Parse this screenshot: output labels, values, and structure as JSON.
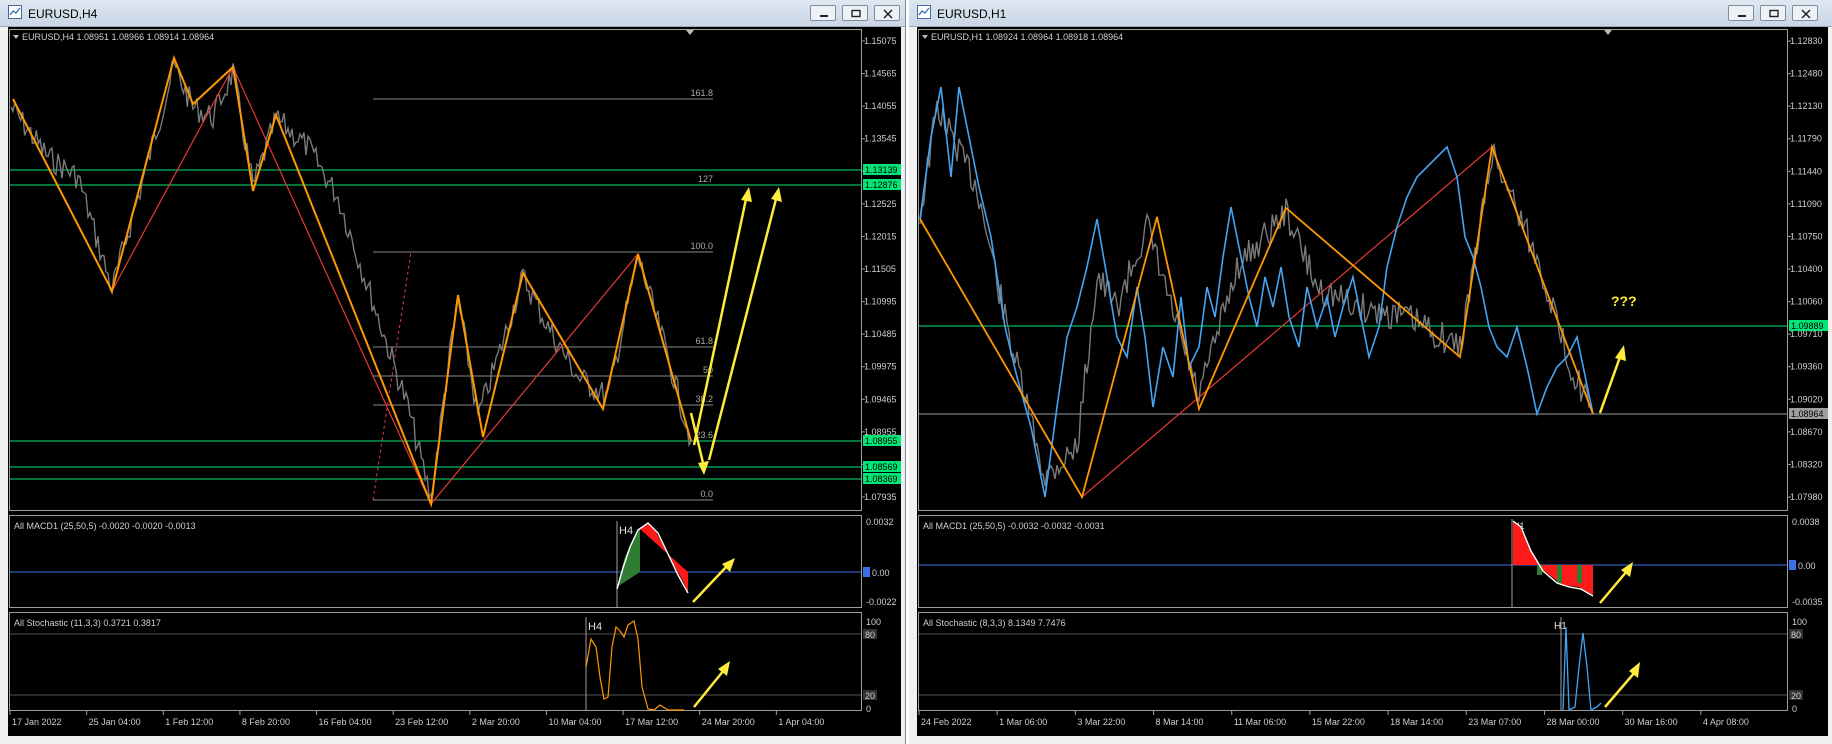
{
  "windows": {
    "left": {
      "title": "EURUSD,H4",
      "header": "EURUSD,H4  1.08951 1.08966 1.08914 1.08964",
      "price_ticks": [
        "1.15075",
        "1.14565",
        "1.14055",
        "1.13545",
        "1.13035",
        "1.12525",
        "1.12015",
        "1.11505",
        "1.10995",
        "1.10485",
        "1.09975",
        "1.09465",
        "1.08955",
        "1.08445",
        "1.07935"
      ],
      "price_labels": [
        {
          "text": "1.13139",
          "color": "#00e676"
        },
        {
          "text": "1.12876",
          "color": "#00e676"
        },
        {
          "text": "1.08955",
          "color": "#00e676"
        },
        {
          "text": "1.08569",
          "color": "#00e676"
        },
        {
          "text": "1.08369",
          "color": "#00e676"
        }
      ],
      "fib_levels": [
        "161.8",
        "127",
        "100.0",
        "61.8",
        "50",
        "38.2",
        "23.6",
        "0.0"
      ],
      "time_labels": [
        "17 Jan 2022",
        "25 Jan 04:00",
        "1 Feb 12:00",
        "8 Feb 20:00",
        "16 Feb 04:00",
        "23 Feb 12:00",
        "2 Mar 20:00",
        "10 Mar 04:00",
        "17 Mar 12:00",
        "24 Mar 20:00",
        "1 Apr 04:00"
      ],
      "macd": {
        "label": "All MACD1 (25,50,5) -0.0020 -0.0020 -0.0013",
        "top": "0.0032",
        "zero": "0.00",
        "bottom": "-0.0022",
        "tf": "H4"
      },
      "stoch": {
        "label": "All Stochastic (11,3,3) 0.3721 0.3817",
        "l100": "100",
        "l80": "80",
        "l20": "20",
        "l0": "0",
        "tf": "H4"
      }
    },
    "right": {
      "title": "EURUSD,H1",
      "header": "EURUSD,H1  1.08924 1.08964 1.08918 1.08964",
      "price_ticks": [
        "1.12830",
        "1.12480",
        "1.12130",
        "1.11790",
        "1.11440",
        "1.11090",
        "1.10750",
        "1.10400",
        "1.10060",
        "1.09710",
        "1.09360",
        "1.09020",
        "1.08670",
        "1.08320",
        "1.07980"
      ],
      "price_labels": [
        {
          "text": "1.09889",
          "color": "#00e676"
        },
        {
          "text": "1.08964",
          "color": "#9e9e9e"
        }
      ],
      "annotation": "???",
      "time_labels": [
        "24 Feb 2022",
        "1 Mar 06:00",
        "3 Mar 22:00",
        "8 Mar 14:00",
        "11 Mar 06:00",
        "15 Mar 22:00",
        "18 Mar 14:00",
        "23 Mar 07:00",
        "28 Mar 00:00",
        "30 Mar 16:00",
        "4 Apr 08:00"
      ],
      "macd": {
        "label": "All MACD1 (25,50,5) -0.0032 -0.0032 -0.0031",
        "top": "0.0038",
        "zero": "0.00",
        "bottom": "-0.0035",
        "tf": "H1"
      },
      "stoch": {
        "label": "All Stochastic (8,3,3) 8.1349 7.7476",
        "l100": "100",
        "l80": "80",
        "l20": "20",
        "l0": "0",
        "tf": "H1"
      }
    }
  },
  "colors": {
    "background": "#000000",
    "zigzag_major": "#ff9800",
    "zigzag_minor": "#e53935",
    "zigzag_h1": "#42a5f5",
    "level_lines": "#00e676",
    "arrows": "#ffeb3b",
    "macd_up": "#2e7d32",
    "macd_down": "#ff1a1a",
    "stoch_line": "#ff9800"
  },
  "icons": {
    "title": "chart-window-icon",
    "minimize": "minimize-icon",
    "restore": "restore-icon",
    "close": "close-icon"
  }
}
